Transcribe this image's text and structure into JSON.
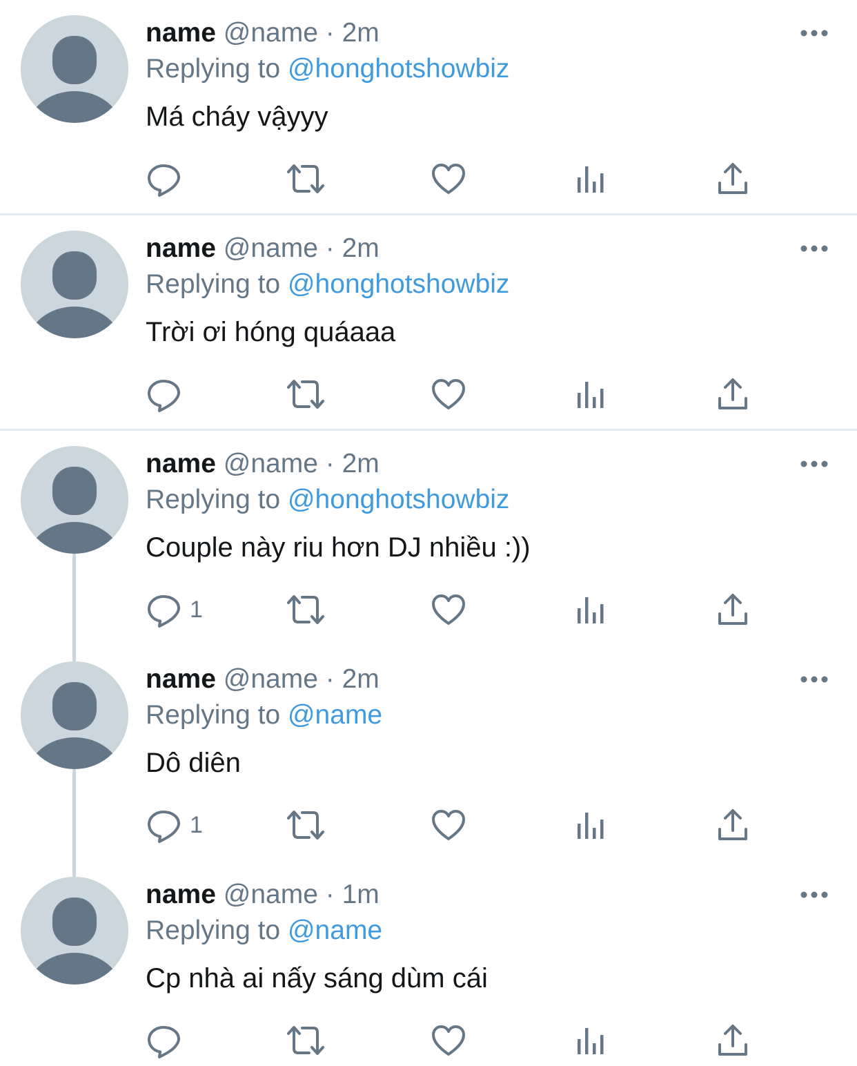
{
  "colors": {
    "text": "#14171a",
    "secondary": "#657786",
    "mention": "#3f9ae0",
    "avatar_bg": "#ccd6dd",
    "avatar_fg": "#657786",
    "divider": "#e6ecf0"
  },
  "icons": {
    "reply": "speech-bubble-icon",
    "retweet": "retweet-arrows-icon",
    "like": "heart-icon",
    "stats": "bar-chart-icon",
    "share": "share-upload-icon",
    "more": "ellipsis-icon"
  },
  "tweets": [
    {
      "display_name": "name",
      "handle": "@name",
      "sep": "·",
      "time": "2m",
      "replying_prefix": "Replying to",
      "replying_to": "@honghotshowbiz",
      "text": "Má cháy vậyyy",
      "reply_count": ""
    },
    {
      "display_name": "name",
      "handle": "@name",
      "sep": "·",
      "time": "2m",
      "replying_prefix": "Replying to",
      "replying_to": "@honghotshowbiz",
      "text": "Trời ơi hóng quáaaa",
      "reply_count": ""
    },
    {
      "display_name": "name",
      "handle": "@name",
      "sep": "·",
      "time": "2m",
      "replying_prefix": "Replying to",
      "replying_to": "@honghotshowbiz",
      "text": "Couple này riu hơn DJ nhiều :))",
      "reply_count": "1"
    },
    {
      "display_name": "name",
      "handle": "@name",
      "sep": "·",
      "time": "2m",
      "replying_prefix": "Replying to",
      "replying_to": "@name",
      "text": "Dô diên",
      "reply_count": "1"
    },
    {
      "display_name": "name",
      "handle": "@name",
      "sep": "·",
      "time": "1m",
      "replying_prefix": "Replying to",
      "replying_to": "@name",
      "text": "Cp nhà ai nấy sáng dùm cái",
      "reply_count": ""
    }
  ]
}
